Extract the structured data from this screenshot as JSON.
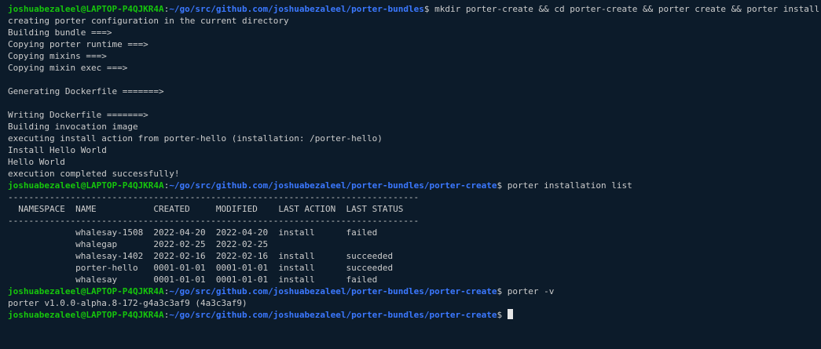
{
  "colors": {
    "background": "#0c1b2a",
    "text": "#cccccc",
    "prompt_user": "#16c60c",
    "prompt_path": "#3b78ff"
  },
  "prompt": {
    "user_host": "joshuabezaleel@LAPTOP-P4QJKR4A",
    "colon": ":",
    "dollar": "$ "
  },
  "paths": {
    "bundles": "~/go/src/github.com/joshuabezaleel/porter-bundles",
    "create": "~/go/src/github.com/joshuabezaleel/porter-bundles/porter-create"
  },
  "commands": {
    "create": "mkdir porter-create && cd porter-create && porter create && porter install --force",
    "list": "porter installation list",
    "version": "porter -v",
    "current": ""
  },
  "output1": [
    "creating porter configuration in the current directory",
    "Building bundle ===>",
    "Copying porter runtime ===>",
    "Copying mixins ===>",
    "Copying mixin exec ===>",
    "",
    "Generating Dockerfile =======>",
    "",
    "Writing Dockerfile =======>",
    "Building invocation image",
    "executing install action from porter-hello (installation: /porter-hello)",
    "Install Hello World",
    "Hello World",
    "execution completed successfully!"
  ],
  "table": {
    "separator": "-------------------------------------------------------------------------------",
    "header": "  NAMESPACE  NAME           CREATED     MODIFIED    LAST ACTION  LAST STATUS",
    "rows": [
      "             whalesay-1508  2022-04-20  2022-04-20  install      failed",
      "             whalegap       2022-02-25  2022-02-25",
      "             whalesay-1402  2022-02-16  2022-02-16  install      succeeded",
      "             porter-hello   0001-01-01  0001-01-01  install      succeeded",
      "             whalesay       0001-01-01  0001-01-01  install      failed"
    ]
  },
  "version_output": "porter v1.0.0-alpha.8-172-g4a3c3af9 (4a3c3af9)"
}
